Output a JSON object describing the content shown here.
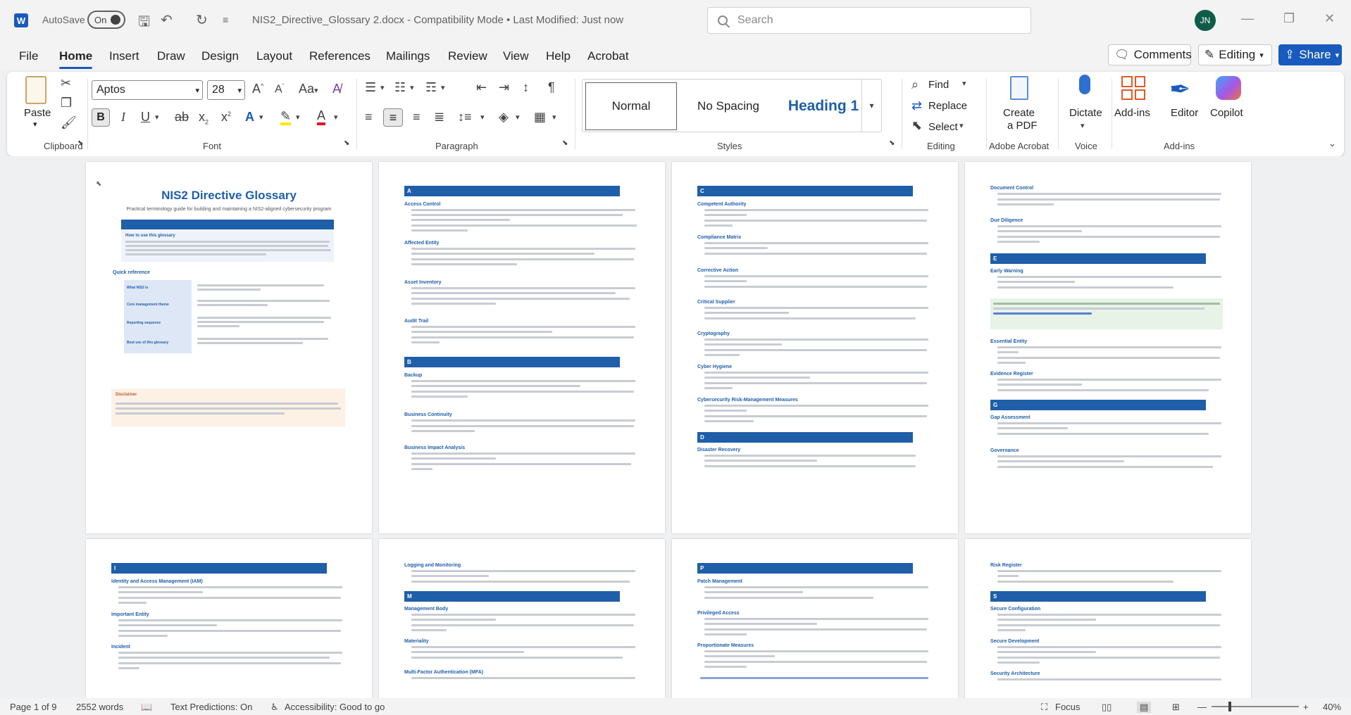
{
  "titlebar": {
    "app_icon": "word-logo",
    "autosave_label": "AutoSave",
    "autosave_state": "On",
    "doc_title": "NIS2_Directive_Glossary 2.docx  -  Compatibility Mode  •  Last Modified: Just now",
    "search_placeholder": "Search",
    "user_initials": "JN"
  },
  "menu": {
    "tabs": [
      "File",
      "Home",
      "Insert",
      "Draw",
      "Design",
      "Layout",
      "References",
      "Mailings",
      "Review",
      "View",
      "Help",
      "Acrobat"
    ],
    "active": "Home",
    "comments": "Comments",
    "editing": "Editing",
    "share": "Share"
  },
  "ribbon": {
    "clipboard": {
      "label": "Clipboard",
      "paste": "Paste"
    },
    "font": {
      "label": "Font",
      "family": "Aptos",
      "size": "28"
    },
    "paragraph": {
      "label": "Paragraph"
    },
    "styles": {
      "label": "Styles",
      "items": [
        "Normal",
        "No Spacing",
        "Heading 1"
      ]
    },
    "editing": {
      "label": "Editing",
      "find": "Find",
      "replace": "Replace",
      "select": "Select"
    },
    "adobe": {
      "label": "Adobe Acrobat",
      "create_pdf_1": "Create",
      "create_pdf_2": "a PDF"
    },
    "voice": {
      "label": "Voice",
      "dictate": "Dictate"
    },
    "addins": {
      "label": "Add-ins",
      "addins": "Add-ins",
      "editor": "Editor",
      "copilot": "Copilot"
    }
  },
  "document": {
    "title": "NIS2 Directive Glossary",
    "subtitle": "Practical terminology guide for building and maintaining a NIS2-aligned cybersecurity program",
    "how_to_use": "How to use this glossary",
    "quick_reference": "Quick reference",
    "quick_rows": [
      "What NIS2 is",
      "Core management theme",
      "Reporting sequence",
      "Best use of this glossary"
    ],
    "disclaimer": "Disclaimer",
    "page2": {
      "head": "A",
      "terms": [
        "Access Control",
        "Affected Entity",
        "Asset Inventory",
        "Audit Trail"
      ],
      "head2": "B",
      "terms2": [
        "Backup",
        "Business Continuity",
        "Business Impact Analysis"
      ]
    },
    "page3": {
      "head": "C",
      "terms": [
        "Competent Authority",
        "Compliance Matrix",
        "Corrective Action",
        "Critical Supplier",
        "Cryptography",
        "Cyber Hygiene",
        "Cybersecurity Risk-Management Measures"
      ],
      "head2": "D",
      "terms2": [
        "Disaster Recovery"
      ]
    },
    "page4": {
      "terms": [
        "Document Control",
        "Due Diligence"
      ],
      "head": "E",
      "terms2": [
        "Early Warning",
        "Essential Entity",
        "Evidence Register"
      ],
      "head2": "G",
      "terms3": [
        "Gap Assessment",
        "Governance"
      ]
    },
    "page5": {
      "head": "I",
      "terms": [
        "Identity and Access Management (IAM)",
        "Important Entity",
        "Incident"
      ]
    },
    "page6": {
      "terms": [
        "Logging and Monitoring"
      ],
      "head": "M",
      "terms2": [
        "Management Body",
        "Materiality",
        "Multi-Factor Authentication (MFA)"
      ]
    },
    "page7": {
      "head": "P",
      "terms": [
        "Patch Management",
        "Privileged Access",
        "Proportionate Measures"
      ]
    },
    "page8": {
      "terms": [
        "Risk Register"
      ],
      "head": "S",
      "terms2": [
        "Secure Configuration",
        "Secure Development",
        "Security Architecture"
      ]
    }
  },
  "status": {
    "page": "Page 1 of 9",
    "words": "2552 words",
    "text_predictions": "Text Predictions: On",
    "accessibility": "Accessibility: Good to go",
    "focus": "Focus",
    "zoom": "40%"
  }
}
